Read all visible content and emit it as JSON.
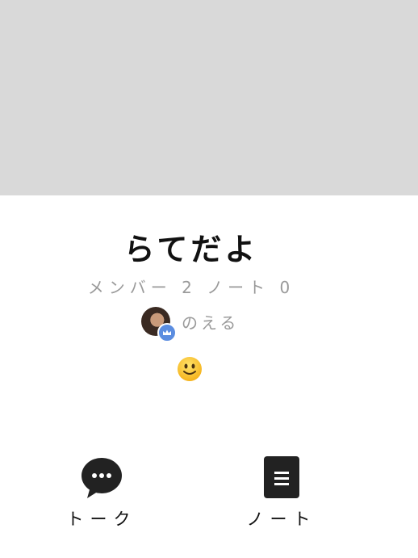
{
  "cover": {
    "color": "#d9d9d9"
  },
  "group": {
    "name": "らてだよ",
    "stats": "メンバー 2 ノート 0",
    "owner_name": "のえる",
    "status_emoji": "🙂"
  },
  "tabs": [
    {
      "label": "トーク",
      "icon": "chat-bubble-icon"
    },
    {
      "label": "ノート",
      "icon": "note-document-icon"
    }
  ],
  "colors": {
    "badge": "#5b8de0",
    "icon": "#222222",
    "muted_text": "#9a9a9a"
  }
}
